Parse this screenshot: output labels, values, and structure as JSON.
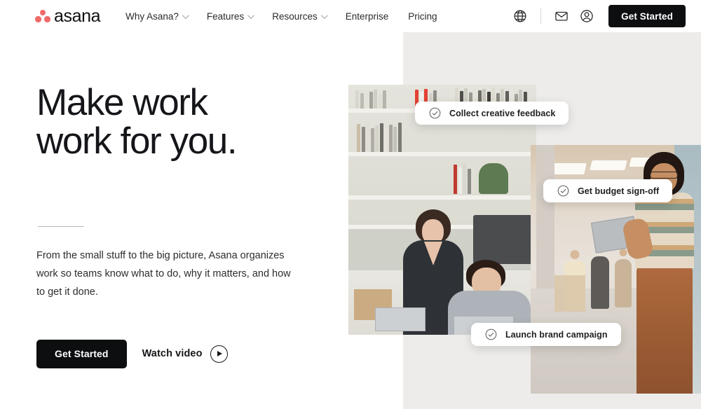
{
  "header": {
    "logo": {
      "text": "asana",
      "dot_color": "#f06a6a",
      "icon": "asana-logo-icon"
    },
    "nav": [
      {
        "label": "Why Asana?",
        "has_dropdown": true
      },
      {
        "label": "Features",
        "has_dropdown": true
      },
      {
        "label": "Resources",
        "has_dropdown": true
      },
      {
        "label": "Enterprise",
        "has_dropdown": false
      },
      {
        "label": "Pricing",
        "has_dropdown": false
      }
    ],
    "icons": [
      {
        "name": "globe-icon"
      },
      {
        "name": "envelope-icon"
      },
      {
        "name": "account-circle-icon"
      }
    ],
    "cta_label": "Get Started"
  },
  "hero": {
    "headline_line1": "Make work",
    "headline_line2": "work for you.",
    "lede": "From the small stuff to the big picture, Asana organizes work so teams know what to do, why it matters, and how to get it done.",
    "primary_cta": "Get Started",
    "secondary_cta": "Watch video",
    "play_icon": "play-circle-icon"
  },
  "task_cards": [
    {
      "label": "Collect creative feedback",
      "icon": "check-circle-icon"
    },
    {
      "label": "Get budget sign-off",
      "icon": "check-circle-icon"
    },
    {
      "label": "Launch brand campaign",
      "icon": "check-circle-icon"
    }
  ],
  "colors": {
    "brand_coral": "#f06a6a",
    "ink": "#0d0e10",
    "panel_gray": "#edecea",
    "page_bg": "#ffffff"
  }
}
